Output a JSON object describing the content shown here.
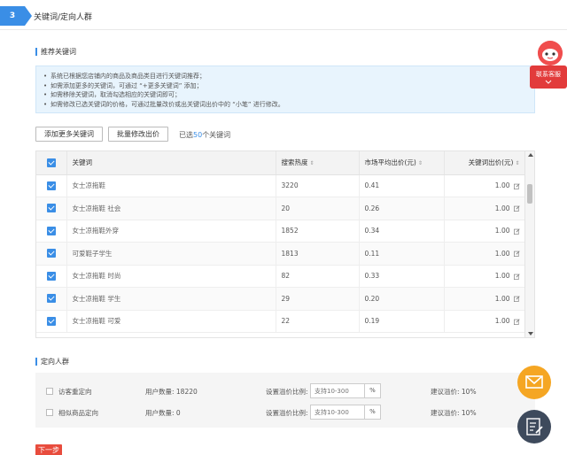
{
  "step": {
    "number": "3",
    "title": "关键词/定向人群"
  },
  "keywords_section": {
    "title": "推荐关键词",
    "info": [
      "系统已根据您店铺内的商品及商品类目进行关键词推荐；",
      "如需添加更多的关键词，可通过 “+更多关键词” 添加；",
      "如需移除关键词，取消勾选相应的关键词即可；",
      "如需修改已选关键词的价格，可通过批量改价或出关键词出价中的 “小笔” 进行修改。"
    ],
    "add_more_label": "添加更多关键词",
    "batch_edit_label": "批量修改出价",
    "selected_prefix": "已选",
    "selected_count": "50",
    "selected_suffix": "个关键词"
  },
  "table": {
    "headers": {
      "keyword": "关键词",
      "popularity": "搜索热度",
      "avg_price": "市场平均出价(元)",
      "bid": "关键词出价(元)"
    },
    "sort_icon": "sort-icon",
    "rows": [
      {
        "keyword": "女士凉拖鞋",
        "popularity": "3220",
        "avg_price": "0.41",
        "bid": "1.00"
      },
      {
        "keyword": "女士凉拖鞋 社会",
        "popularity": "20",
        "avg_price": "0.26",
        "bid": "1.00"
      },
      {
        "keyword": "女士凉拖鞋外穿",
        "popularity": "1852",
        "avg_price": "0.34",
        "bid": "1.00"
      },
      {
        "keyword": "可爱鞋子学生",
        "popularity": "1813",
        "avg_price": "0.11",
        "bid": "1.00"
      },
      {
        "keyword": "女士凉拖鞋 时尚",
        "popularity": "82",
        "avg_price": "0.33",
        "bid": "1.00"
      },
      {
        "keyword": "女士凉拖鞋 学生",
        "popularity": "29",
        "avg_price": "0.20",
        "bid": "1.00"
      },
      {
        "keyword": "女士凉拖鞋 可爱",
        "popularity": "22",
        "avg_price": "0.19",
        "bid": "1.00"
      }
    ]
  },
  "crowd_section": {
    "title": "定向人群",
    "rows": [
      {
        "label": "访客重定向",
        "users": "用户数量: 18220",
        "ratio_label": "设置溢价比例:",
        "placeholder": "支持10-300",
        "unit": "%",
        "suggest": "建议溢价: 10%"
      },
      {
        "label": "相似商品定向",
        "users": "用户数量: 0",
        "ratio_label": "设置溢价比例:",
        "placeholder": "支持10-300",
        "unit": "%",
        "suggest": "建议溢价: 10%"
      }
    ]
  },
  "next_label": "下一步",
  "contact": {
    "label": "联系客服"
  },
  "colors": {
    "accent": "#3a8ee6",
    "danger": "#e84c3d",
    "info_bg": "#e8f4fd",
    "mail": "#f5a623",
    "edit": "#3e4a5c"
  }
}
